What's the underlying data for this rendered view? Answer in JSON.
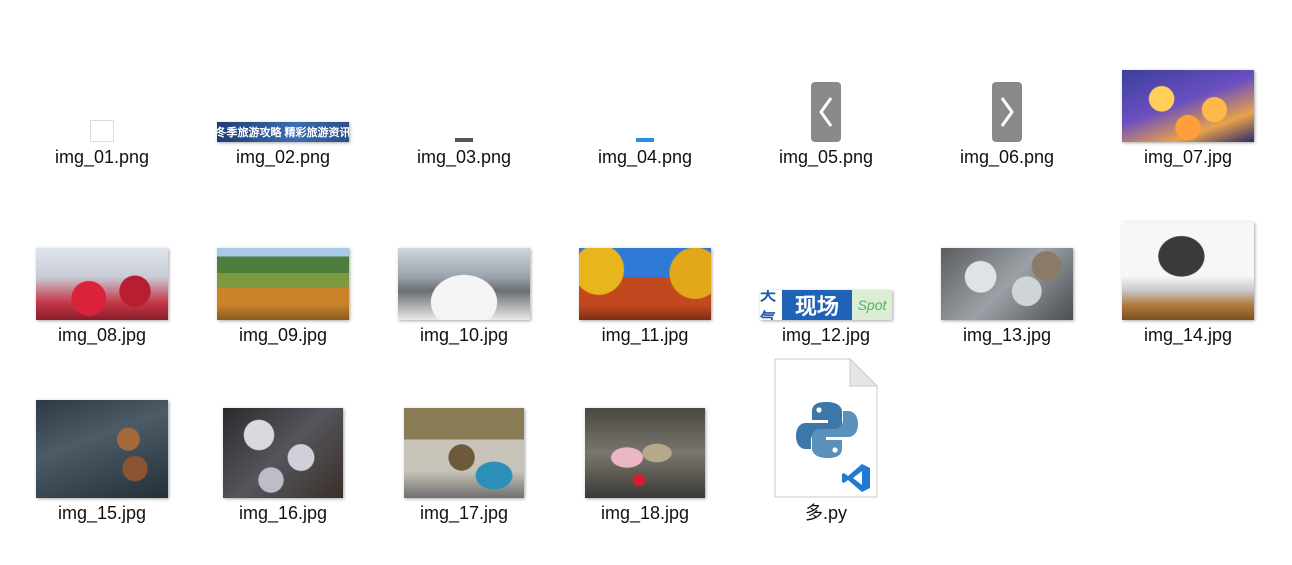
{
  "files": [
    {
      "name": "img_01.png",
      "thumb": "blank-white"
    },
    {
      "name": "img_02.png",
      "thumb": "banner",
      "banner_text": "冬季旅游攻略 精彩旅游资讯"
    },
    {
      "name": "img_03.png",
      "thumb": "mini-dark"
    },
    {
      "name": "img_04.png",
      "thumb": "mini-blue"
    },
    {
      "name": "img_05.png",
      "thumb": "arrow-left"
    },
    {
      "name": "img_06.png",
      "thumb": "arrow-right"
    },
    {
      "name": "img_07.jpg",
      "thumb": "snow-village"
    },
    {
      "name": "img_08.jpg",
      "thumb": "red-leaves"
    },
    {
      "name": "img_09.jpg",
      "thumb": "autumn-valley"
    },
    {
      "name": "img_10.jpg",
      "thumb": "cloud-mountains"
    },
    {
      "name": "img_11.jpg",
      "thumb": "temple-ginkgo"
    },
    {
      "name": "img_12.jpg",
      "thumb": "weather-banner",
      "weather_text_1": "天气",
      "weather_text_2": "现场",
      "weather_text_3": "Spot"
    },
    {
      "name": "img_13.jpg",
      "thumb": "frost-leaves"
    },
    {
      "name": "img_14.jpg",
      "thumb": "frozen-tree"
    },
    {
      "name": "img_15.jpg",
      "thumb": "ice-leaves"
    },
    {
      "name": "img_16.jpg",
      "thumb": "frost-crystals"
    },
    {
      "name": "img_17.jpg",
      "thumb": "street-rider"
    },
    {
      "name": "img_18.jpg",
      "thumb": "crowd-winter"
    },
    {
      "name": "多.py",
      "thumb": "python-file"
    }
  ]
}
